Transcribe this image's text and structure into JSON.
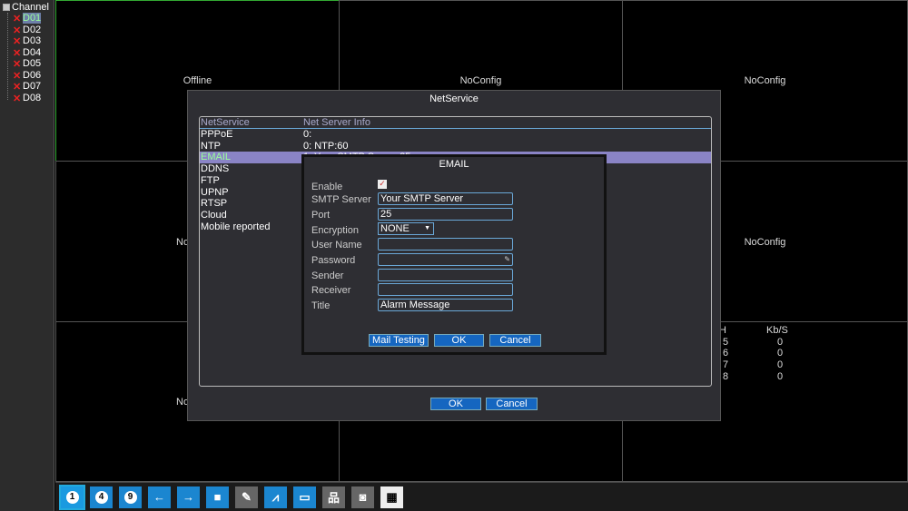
{
  "sidebar": {
    "title": "Channel",
    "channels": [
      "D01",
      "D02",
      "D03",
      "D04",
      "D05",
      "D06",
      "D07",
      "D08"
    ],
    "selected": "D01",
    "status_icon": "red-x-icon"
  },
  "grid": {
    "cells": [
      "",
      "NoConfig",
      "NoConfig",
      "",
      "",
      "NoConfig",
      "",
      "",
      ""
    ],
    "labels": {
      "c0": "Offline",
      "c1": "NoConfig",
      "c2": "NoConfig",
      "c3": "No",
      "c5": "NoConfig",
      "c6": "No"
    }
  },
  "stats": {
    "header": [
      "H",
      "Kb/S"
    ],
    "rows": [
      [
        "5",
        "0"
      ],
      [
        "6",
        "0"
      ],
      [
        "7",
        "0"
      ],
      [
        "8",
        "0"
      ]
    ]
  },
  "netservice": {
    "title": "NetService",
    "columns": [
      "NetService",
      "Net Server Info"
    ],
    "rows": [
      [
        "PPPoE",
        "0:"
      ],
      [
        "NTP",
        "0: NTP:60"
      ],
      [
        "EMAIL",
        "1: Your SMTP Server:25"
      ],
      [
        "DDNS",
        ""
      ],
      [
        "FTP",
        ""
      ],
      [
        "UPNP",
        ""
      ],
      [
        "RTSP",
        ""
      ],
      [
        "Cloud",
        ""
      ],
      [
        "Mobile reported",
        ""
      ]
    ],
    "selected": "EMAIL",
    "ok": "OK",
    "cancel": "Cancel"
  },
  "email": {
    "title": "EMAIL",
    "enable_label": "Enable",
    "enable": true,
    "smtp_label": "SMTP Server",
    "smtp": "Your SMTP Server",
    "port_label": "Port",
    "port": "25",
    "encryption_label": "Encryption",
    "encryption": "NONE",
    "user_label": "User Name",
    "user": "",
    "password_label": "Password",
    "password": "",
    "sender_label": "Sender",
    "sender": "",
    "receiver_label": "Receiver",
    "receiver": "",
    "title_label": "Title",
    "title_value": "Alarm Message",
    "mail_testing": "Mail Testing",
    "ok": "OK",
    "cancel": "Cancel"
  },
  "toolbar": {
    "items": [
      "1",
      "4",
      "9",
      "arrow-left-icon",
      "arrow-right-icon",
      "fullscreen-icon",
      "ptz-camera-icon",
      "chart-icon",
      "monitor-icon",
      "network-icon",
      "hdd-icon",
      "qrcode-icon"
    ]
  }
}
